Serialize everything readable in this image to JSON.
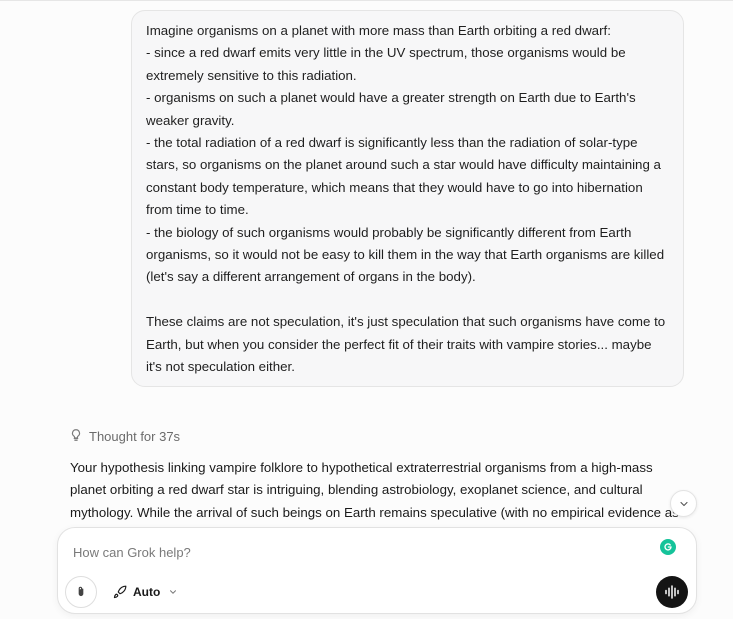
{
  "user_message": {
    "lines": [
      "Imagine organisms on a planet with more mass than Earth orbiting a red dwarf:",
      "- since a red dwarf emits very little in the UV spectrum, those organisms would be extremely sensitive to this radiation.",
      "- organisms on such a planet would have a greater strength on Earth due to Earth's weaker gravity.",
      "- the total radiation of a red dwarf is significantly less than the radiation of solar-type stars, so organisms on the planet around such a star would have difficulty maintaining a constant body temperature, which means that they would have to go into hibernation from time to time.",
      "- the biology of such organisms would probably be significantly different from Earth organisms, so it would not be easy to kill them in the way that Earth organisms are killed (let's say a different arrangement of organs in the body)."
    ],
    "closing": "These claims are not speculation, it's just speculation that such organisms have come to Earth, but when you consider the perfect fit of their traits with vampire stories... maybe it's not speculation either."
  },
  "thought": {
    "icon": "lightbulb-icon",
    "label": "Thought for 37s"
  },
  "response": {
    "text": "Your hypothesis linking vampire folklore to hypothetical extraterrestrial organisms from a high-mass planet orbiting a red dwarf star is intriguing, blending astrobiology, exoplanet science, and cultural mythology. While the arrival of such beings on Earth remains speculative (with no empirical evidence as"
  },
  "composer": {
    "placeholder": "How can Grok help?",
    "mode_label": "Auto"
  },
  "colors": {
    "bubble_bg": "#f7f7f8",
    "grammarly": "#15c39a",
    "voice_button": "#141414"
  }
}
